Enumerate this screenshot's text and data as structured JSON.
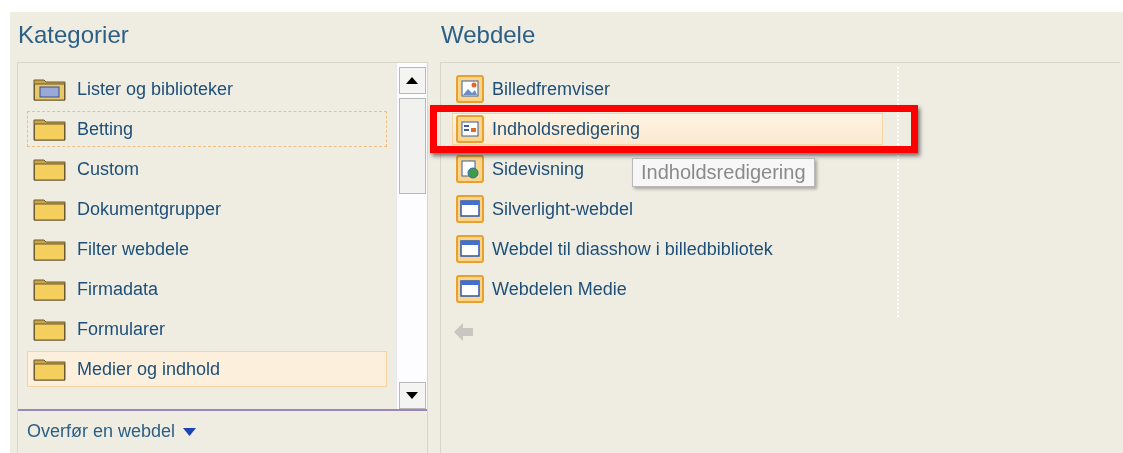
{
  "categories": {
    "title": "Kategorier",
    "items": [
      {
        "label": "Lister og biblioteker",
        "kind": "list",
        "selected": false,
        "focused": false
      },
      {
        "label": "Betting",
        "kind": "folder",
        "selected": false,
        "focused": true
      },
      {
        "label": "Custom",
        "kind": "folder",
        "selected": false,
        "focused": false
      },
      {
        "label": "Dokumentgrupper",
        "kind": "folder",
        "selected": false,
        "focused": false
      },
      {
        "label": "Filter webdele",
        "kind": "folder",
        "selected": false,
        "focused": false
      },
      {
        "label": "Firmadata",
        "kind": "folder",
        "selected": false,
        "focused": false
      },
      {
        "label": "Formularer",
        "kind": "folder",
        "selected": false,
        "focused": false
      },
      {
        "label": "Medier og indhold",
        "kind": "folder",
        "selected": true,
        "focused": false
      }
    ],
    "upload_link": "Overfør en webdel"
  },
  "webparts": {
    "title": "Webdele",
    "items": [
      {
        "label": "Billedfremviser",
        "kind": "image",
        "selected": false
      },
      {
        "label": "Indholdsredigering",
        "kind": "content",
        "selected": true
      },
      {
        "label": "Sidevisning",
        "kind": "page",
        "selected": false
      },
      {
        "label": "Silverlight-webdel",
        "kind": "window",
        "selected": false
      },
      {
        "label": "Webdel til diasshow i billedbibliotek",
        "kind": "window",
        "selected": false
      },
      {
        "label": "Webdelen Medie",
        "kind": "window",
        "selected": false
      }
    ],
    "tooltip": "Indholdsredigering"
  }
}
